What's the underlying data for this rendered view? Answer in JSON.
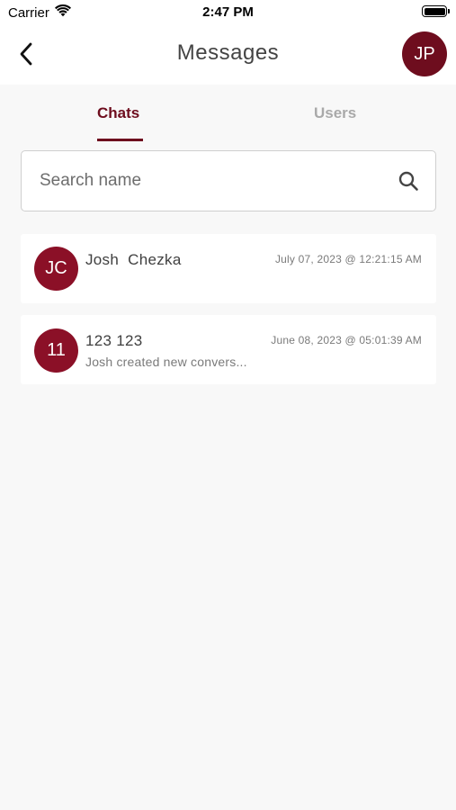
{
  "status_bar": {
    "carrier": "Carrier",
    "time": "2:47 PM"
  },
  "header": {
    "title": "Messages",
    "profile_initials": "JP"
  },
  "tabs": [
    {
      "label": "Chats",
      "active": true
    },
    {
      "label": "Users",
      "active": false
    }
  ],
  "search": {
    "placeholder": "Search name",
    "value": ""
  },
  "chats": [
    {
      "initials": "JC",
      "name": "Josh  Chezka",
      "timestamp": "July 07, 2023 @ 12:21:15 AM",
      "preview": ""
    },
    {
      "initials": "11",
      "name": "123 123",
      "timestamp": "June 08, 2023 @ 05:01:39 AM",
      "preview": "Josh created new convers..."
    }
  ],
  "colors": {
    "accent": "#6e0d1e",
    "avatar": "#8b1027",
    "inactive_tab": "#a9a9a9",
    "background": "#f8f8f8"
  }
}
